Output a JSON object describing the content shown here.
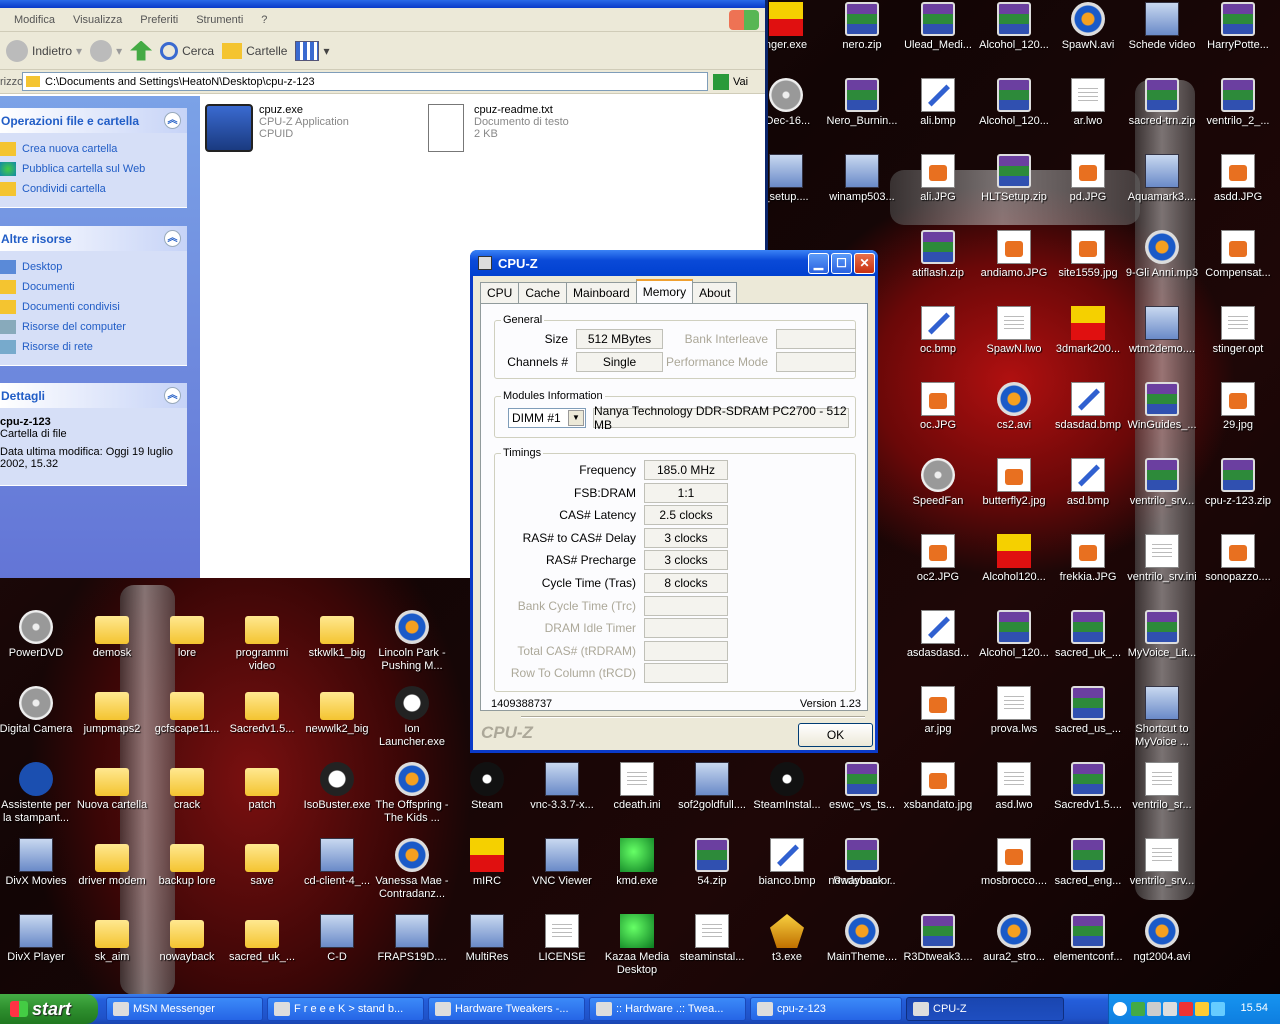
{
  "desktop": {
    "icons": [
      {
        "label": "nger.exe",
        "type": "red"
      },
      {
        "label": "nero.zip",
        "type": "rar"
      },
      {
        "label": "Ulead_Medi...",
        "type": "rar"
      },
      {
        "label": "Alcohol_120...",
        "type": "rar"
      },
      {
        "label": "SpawN.avi",
        "type": "media"
      },
      {
        "label": "Schede video",
        "type": "exe"
      },
      {
        "label": "HarryPotte...",
        "type": "rar"
      },
      {
        "label": "-Dec-16...",
        "type": "cd"
      },
      {
        "label": "Nero_Burnin...",
        "type": "rar"
      },
      {
        "label": "ali.bmp",
        "type": "bmp"
      },
      {
        "label": "Alcohol_120...",
        "type": "rar"
      },
      {
        "label": "ar.lwo",
        "type": "doc"
      },
      {
        "label": "sacred-trn.zip",
        "type": "rar"
      },
      {
        "label": "ventrilo_2_...",
        "type": "rar"
      },
      {
        "label": "_setup....",
        "type": "exe"
      },
      {
        "label": "winamp503...",
        "type": "exe"
      },
      {
        "label": "ali.JPG",
        "type": "jpg"
      },
      {
        "label": "HLTSetup.zip",
        "type": "rar"
      },
      {
        "label": "pd.JPG",
        "type": "jpg"
      },
      {
        "label": "Aquamark3....",
        "type": "exe"
      },
      {
        "label": "asdd.JPG",
        "type": "jpg"
      },
      {
        "label": "atiflash.zip",
        "type": "rar"
      },
      {
        "label": "andiamo.JPG",
        "type": "jpg"
      },
      {
        "label": "site1559.jpg",
        "type": "jpg"
      },
      {
        "label": "9-Gli Anni.mp3",
        "type": "media"
      },
      {
        "label": "Compensat...",
        "type": "jpg"
      },
      {
        "label": "oc.bmp",
        "type": "bmp"
      },
      {
        "label": "SpawN.lwo",
        "type": "doc"
      },
      {
        "label": "3dmark200...",
        "type": "red"
      },
      {
        "label": "wtm2demo....",
        "type": "exe"
      },
      {
        "label": "stinger.opt",
        "type": "doc"
      },
      {
        "label": "oc.JPG",
        "type": "jpg"
      },
      {
        "label": "cs2.avi",
        "type": "media"
      },
      {
        "label": "sdasdad.bmp",
        "type": "bmp"
      },
      {
        "label": "WinGuides_...",
        "type": "rar"
      },
      {
        "label": "29.jpg",
        "type": "jpg"
      },
      {
        "label": "SpeedFan",
        "type": "cd"
      },
      {
        "label": "butterfly2.jpg",
        "type": "jpg"
      },
      {
        "label": "asd.bmp",
        "type": "bmp"
      },
      {
        "label": "ventrilo_srv...",
        "type": "rar"
      },
      {
        "label": "cpu-z-123.zip",
        "type": "rar"
      },
      {
        "label": "oc2.JPG",
        "type": "jpg"
      },
      {
        "label": "Alcohol120...",
        "type": "red"
      },
      {
        "label": "frekkia.JPG",
        "type": "jpg"
      },
      {
        "label": "ventrilo_srv.ini",
        "type": "doc"
      },
      {
        "label": "sonopazzo....",
        "type": "jpg"
      },
      {
        "label": "asdasdasd...",
        "type": "bmp"
      },
      {
        "label": "Alcohol_120...",
        "type": "rar"
      },
      {
        "label": "sacred_uk_...",
        "type": "rar"
      },
      {
        "label": "MyVoice_Lit...",
        "type": "rar"
      },
      {
        "label": "ar.jpg",
        "type": "jpg"
      },
      {
        "label": "prova.lws",
        "type": "doc"
      },
      {
        "label": "sacred_us_...",
        "type": "rar"
      },
      {
        "label": "Shortcut to MyVoice ...",
        "type": "exe"
      },
      {
        "label": "xsbandato.jpg",
        "type": "jpg"
      },
      {
        "label": "asd.lwo",
        "type": "doc"
      },
      {
        "label": "Sacredv1.5....",
        "type": "rar"
      },
      {
        "label": "ventrilo_sr...",
        "type": "doc"
      },
      {
        "label": "Radeonator",
        "type": "cd"
      },
      {
        "label": "mosbrocco....",
        "type": "jpg"
      },
      {
        "label": "sacred_eng...",
        "type": "rar"
      },
      {
        "label": "ventrilo_srv...",
        "type": "doc"
      },
      {
        "label": "MainTheme....",
        "type": "media"
      },
      {
        "label": "R3Dtweak3....",
        "type": "rar"
      },
      {
        "label": "aura2_stro...",
        "type": "media"
      },
      {
        "label": "elementconf...",
        "type": "rar"
      },
      {
        "label": "ngt2004.avi",
        "type": "media"
      },
      {
        "label": "PowerDVD",
        "type": "cd"
      },
      {
        "label": "demosk",
        "type": "fold"
      },
      {
        "label": "lore",
        "type": "fold"
      },
      {
        "label": "programmi video",
        "type": "fold"
      },
      {
        "label": "stkwlk1_big",
        "type": "fold"
      },
      {
        "label": "Lincoln Park - Pushing M...",
        "type": "media"
      },
      {
        "label": "Digital Camera",
        "type": "cd"
      },
      {
        "label": "jumpmaps2",
        "type": "fold"
      },
      {
        "label": "gcfscape11...",
        "type": "fold"
      },
      {
        "label": "Sacredv1.5...",
        "type": "fold"
      },
      {
        "label": "newwlk2_big",
        "type": "fold"
      },
      {
        "label": "Ion Launcher.exe",
        "type": "ion"
      },
      {
        "label": "Assistente per la stampant...",
        "type": "hp"
      },
      {
        "label": "Nuova cartella",
        "type": "fold"
      },
      {
        "label": "crack",
        "type": "fold"
      },
      {
        "label": "patch",
        "type": "fold"
      },
      {
        "label": "IsoBuster.exe",
        "type": "ion"
      },
      {
        "label": "The Offspring - The Kids ...",
        "type": "media"
      },
      {
        "label": "Steam",
        "type": "steam"
      },
      {
        "label": "vnc-3.3.7-x...",
        "type": "exe"
      },
      {
        "label": "cdeath.ini",
        "type": "doc"
      },
      {
        "label": "sof2goldfull....",
        "type": "exe"
      },
      {
        "label": "SteamInstal...",
        "type": "steam"
      },
      {
        "label": "eswc_vs_ts...",
        "type": "rar"
      },
      {
        "label": "DivX Movies",
        "type": "exe"
      },
      {
        "label": "driver modem",
        "type": "fold"
      },
      {
        "label": "backup lore",
        "type": "fold"
      },
      {
        "label": "save",
        "type": "fold"
      },
      {
        "label": "cd-client-4_...",
        "type": "exe"
      },
      {
        "label": "Vanessa Mae - Contradanz...",
        "type": "media"
      },
      {
        "label": "mIRC",
        "type": "red"
      },
      {
        "label": "VNC Viewer",
        "type": "exe"
      },
      {
        "label": "kmd.exe",
        "type": "kmd"
      },
      {
        "label": "54.zip",
        "type": "rar"
      },
      {
        "label": "bianco.bmp",
        "type": "bmp"
      },
      {
        "label": "nowayback....",
        "type": "rar"
      },
      {
        "label": "DivX Player",
        "type": "exe"
      },
      {
        "label": "sk_aim",
        "type": "fold"
      },
      {
        "label": "nowayback",
        "type": "fold"
      },
      {
        "label": "sacred_uk_...",
        "type": "fold"
      },
      {
        "label": "C-D",
        "type": "exe"
      },
      {
        "label": "FRAPS19D....",
        "type": "exe"
      },
      {
        "label": "MultiRes",
        "type": "exe"
      },
      {
        "label": "LICENSE",
        "type": "doc"
      },
      {
        "label": "Kazaa Media Desktop",
        "type": "kmd"
      },
      {
        "label": "steaminstal...",
        "type": "doc"
      },
      {
        "label": "t3.exe",
        "type": "t3"
      }
    ]
  },
  "explorer": {
    "menu": [
      "Modifica",
      "Visualizza",
      "Preferiti",
      "Strumenti",
      "?"
    ],
    "toolbar": {
      "back": "Indietro",
      "search": "Cerca",
      "folders": "Cartelle"
    },
    "address": {
      "label": "rizzo",
      "path": "C:\\Documents and Settings\\HeatoN\\Desktop\\cpu-z-123",
      "go": "Vai"
    },
    "tasks_title": "Operazioni file e cartella",
    "tasks": [
      "Crea nuova cartella",
      "Pubblica cartella sul Web",
      "Condividi cartella"
    ],
    "other_title": "Altre risorse",
    "other": [
      "Desktop",
      "Documenti",
      "Documenti condivisi",
      "Risorse del computer",
      "Risorse di rete"
    ],
    "details_title": "Dettagli",
    "details": {
      "name": "cpu-z-123",
      "type": "Cartella di file",
      "modified": "Data ultima modifica: Oggi 19 luglio 2002, 15.32"
    },
    "files": [
      {
        "name": "cpuz.exe",
        "line2": "CPU-Z Application",
        "line3": "CPUID"
      },
      {
        "name": "cpuz-readme.txt",
        "line2": "Documento di testo",
        "line3": "2 KB"
      }
    ]
  },
  "cpuz": {
    "title": "CPU-Z",
    "tabs": [
      "CPU",
      "Cache",
      "Mainboard",
      "Memory",
      "About"
    ],
    "general": {
      "legend": "General",
      "size_label": "Size",
      "size": "512 MBytes",
      "channels_label": "Channels #",
      "channels": "Single",
      "interleave_label": "Bank Interleave",
      "perf_label": "Performance Mode"
    },
    "modules": {
      "legend": "Modules Information",
      "slot": "DIMM #1",
      "desc": "Nanya Technology DDR-SDRAM PC2700 - 512 MB"
    },
    "timings": {
      "legend": "Timings",
      "rows": [
        {
          "label": "Frequency",
          "value": "185.0 MHz"
        },
        {
          "label": "FSB:DRAM",
          "value": "1:1"
        },
        {
          "label": "CAS# Latency",
          "value": "2.5 clocks"
        },
        {
          "label": "RAS# to CAS# Delay",
          "value": "3 clocks"
        },
        {
          "label": "RAS# Precharge",
          "value": "3 clocks"
        },
        {
          "label": "Cycle Time (Tras)",
          "value": "8 clocks"
        },
        {
          "label": "Bank Cycle Time (Trc)",
          "value": ""
        },
        {
          "label": "DRAM Idle Timer",
          "value": ""
        },
        {
          "label": "Total CAS# (tRDRAM)",
          "value": ""
        },
        {
          "label": "Row To Column (tRCD)",
          "value": ""
        }
      ]
    },
    "serial": "1409388737",
    "version": "Version 1.23",
    "brand": "CPU-Z",
    "ok": "OK"
  },
  "taskbar": {
    "start": "start",
    "tasks": [
      "MSN Messenger",
      "F r e e e K > stand b...",
      "Hardware Tweakers -...",
      ":: Hardware .:: Twea...",
      "cpu-z-123",
      "CPU-Z"
    ],
    "clock": "15.54"
  }
}
